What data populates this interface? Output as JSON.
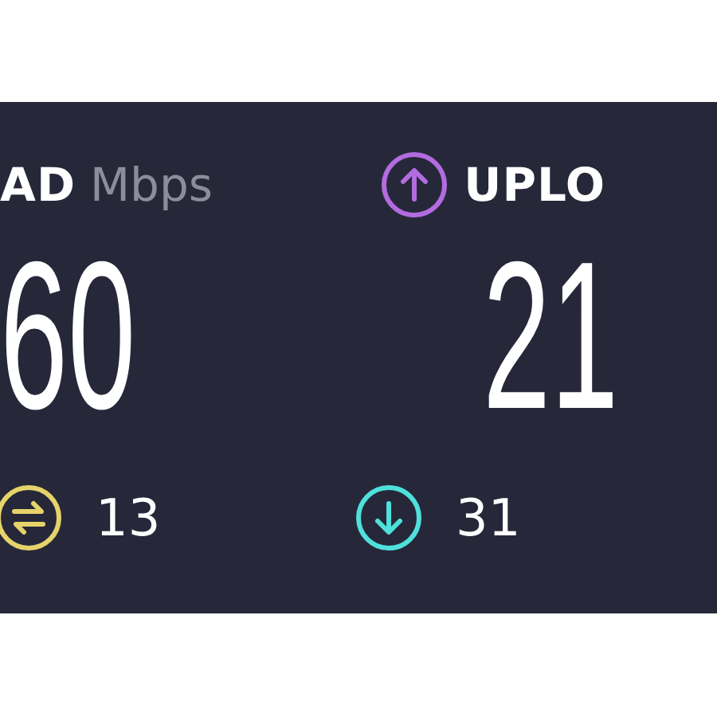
{
  "download": {
    "label": "AD",
    "unit": "Mbps",
    "value": "60"
  },
  "upload": {
    "label": "UPLO",
    "value": "21",
    "color": "#b36be0"
  },
  "stats": [
    {
      "kind": "jitter",
      "value": "13",
      "color": "#e6d36a"
    },
    {
      "kind": "down",
      "value": "31",
      "color": "#4fe0dc"
    }
  ]
}
